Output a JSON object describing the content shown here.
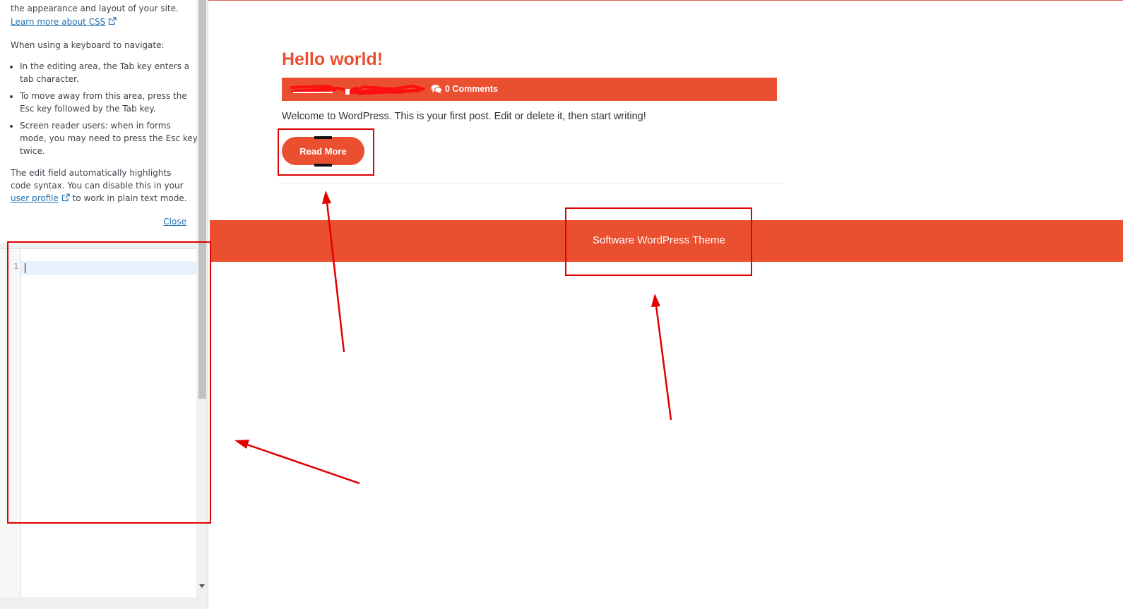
{
  "sidebar": {
    "help_intro_tail": "the appearance and layout of your site.",
    "learn_more_link": "Learn more about CSS",
    "keyboard_intro": "When using a keyboard to navigate:",
    "bullets": [
      "In the editing area, the Tab key enters a tab character.",
      "To move away from this area, press the Esc key followed by the Tab key.",
      "Screen reader users: when in forms mode, you may need to press the Esc key twice."
    ],
    "syntax_text_before": "The edit field automatically highlights code syntax. You can disable this in your ",
    "user_profile_link": "user profile",
    "syntax_text_after": " to work in plain text mode.",
    "close_link": "Close",
    "editor": {
      "line_number": "1"
    },
    "icons": {
      "external_link": "external-link-icon"
    }
  },
  "preview": {
    "post_title": "Hello world!",
    "meta": {
      "comments_icon": "comments-icon",
      "comments_label": "0 Comments"
    },
    "excerpt": "Welcome to WordPress. This is your first post. Edit or delete it, then start writing!",
    "read_more_label": "Read More",
    "footer_text": "Software WordPress Theme"
  },
  "colors": {
    "accent": "#ea4f30",
    "link": "#2271b1",
    "annotation": "#e00000"
  }
}
